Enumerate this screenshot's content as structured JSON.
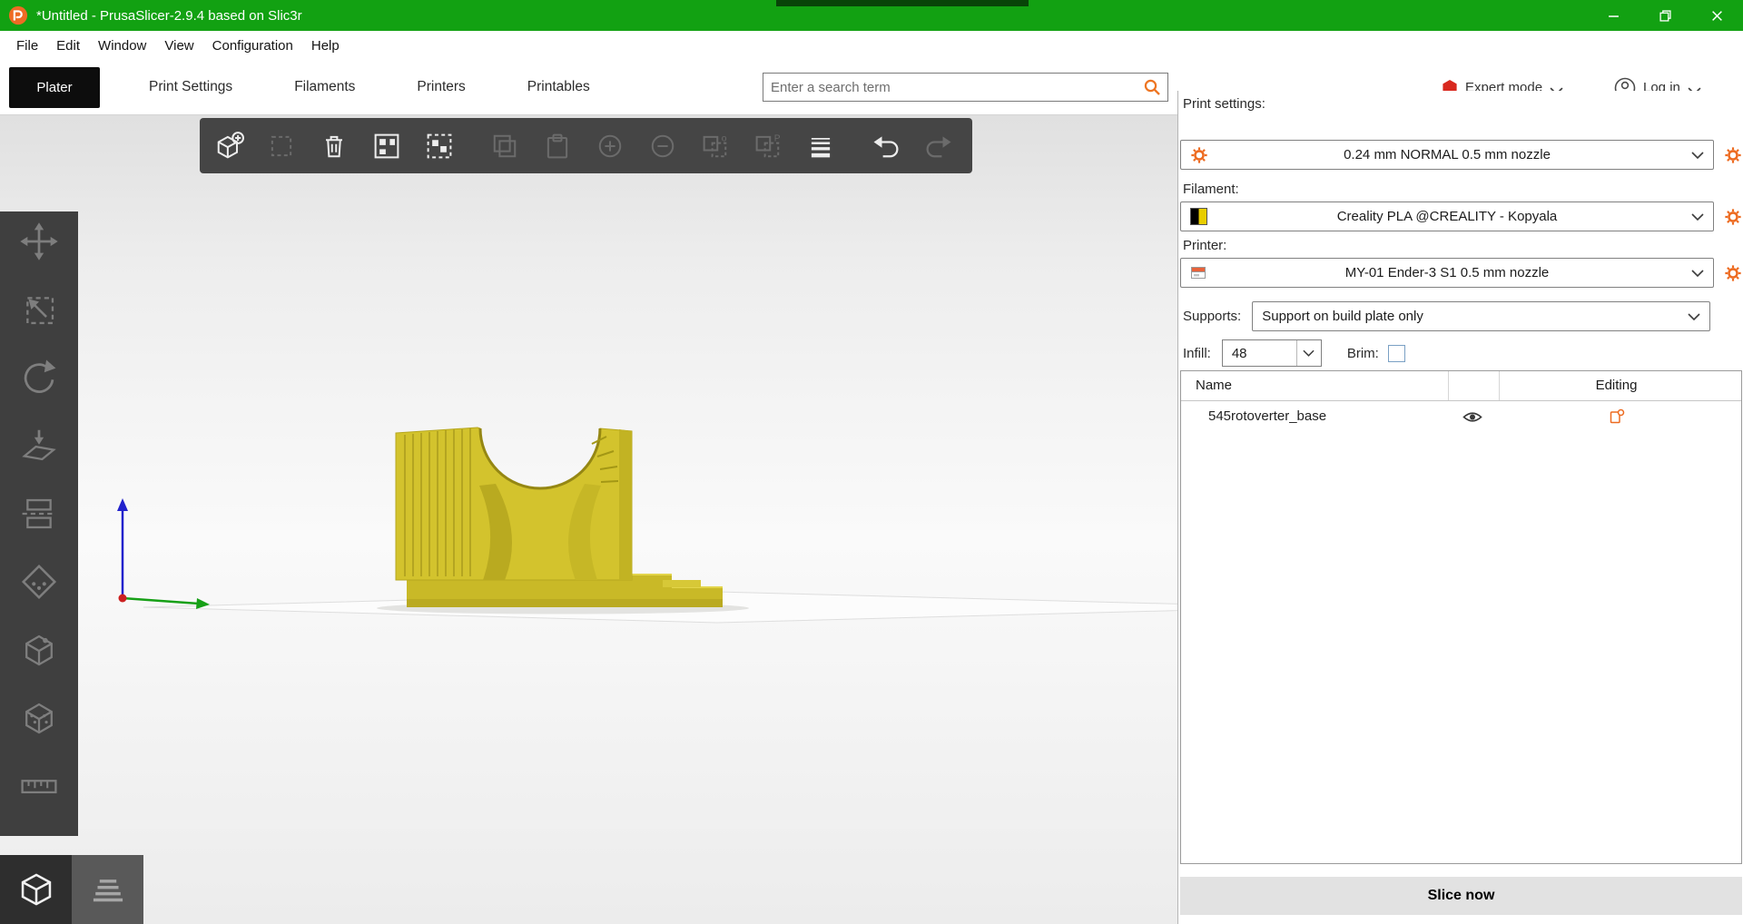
{
  "window": {
    "title": "*Untitled - PrusaSlicer-2.9.4 based on Slic3r"
  },
  "menubar": {
    "items": [
      "File",
      "Edit",
      "Window",
      "View",
      "Configuration",
      "Help"
    ]
  },
  "tabbar": {
    "tabs": [
      {
        "label": "Plater",
        "active": true
      },
      {
        "label": "Print Settings",
        "active": false
      },
      {
        "label": "Filaments",
        "active": false
      },
      {
        "label": "Printers",
        "active": false
      },
      {
        "label": "Printables",
        "active": false
      }
    ],
    "search_placeholder": "Enter a search term",
    "expert_mode_label": "Expert mode",
    "login_label": "Log in"
  },
  "viewport": {
    "toolbar_top": [
      {
        "name": "add-object",
        "enabled": true
      },
      {
        "name": "delete",
        "enabled": false
      },
      {
        "name": "delete-all",
        "enabled": true
      },
      {
        "name": "arrange",
        "enabled": true
      },
      {
        "name": "arrange-bed",
        "enabled": true
      },
      {
        "name": "copy",
        "enabled": false
      },
      {
        "name": "paste",
        "enabled": false
      },
      {
        "name": "add-instance",
        "enabled": false
      },
      {
        "name": "remove-instance",
        "enabled": false
      },
      {
        "name": "split-objects",
        "enabled": false
      },
      {
        "name": "split-parts",
        "enabled": false
      },
      {
        "name": "layer-height",
        "enabled": true
      },
      {
        "name": "undo",
        "enabled": true
      },
      {
        "name": "redo",
        "enabled": false
      }
    ],
    "toolbar_left": [
      {
        "name": "move",
        "enabled": false
      },
      {
        "name": "scale",
        "enabled": false
      },
      {
        "name": "rotate",
        "enabled": false
      },
      {
        "name": "place-on-face",
        "enabled": false
      },
      {
        "name": "cut",
        "enabled": false
      },
      {
        "name": "paint-supports",
        "enabled": false
      },
      {
        "name": "seam",
        "enabled": false
      },
      {
        "name": "fuzzy-skin",
        "enabled": false
      },
      {
        "name": "measure",
        "enabled": false
      }
    ],
    "view_buttons": [
      {
        "name": "editor-3d",
        "active": true
      },
      {
        "name": "preview-layers",
        "active": false
      }
    ]
  },
  "sidebar": {
    "print_settings_label": "Print settings:",
    "print_settings_value": "0.24 mm NORMAL 0.5 mm nozzle",
    "filament_label": "Filament:",
    "filament_value": "Creality PLA @CREALITY - Kopyala",
    "printer_label": "Printer:",
    "printer_value": "MY-01 Ender-3 S1 0.5 mm nozzle",
    "supports_label": "Supports:",
    "supports_value": "Support on build plate only",
    "infill_label": "Infill:",
    "infill_value": "48",
    "brim_label": "Brim:",
    "brim_checked": false,
    "object_list": {
      "columns": [
        "Name",
        "Editing"
      ],
      "rows": [
        {
          "name": "545rotoverter_base"
        }
      ]
    },
    "slice_button_label": "Slice now"
  },
  "colors": {
    "titlebar_green": "#12a112",
    "accent_orange": "#ed6b21",
    "expert_red": "#d8281e",
    "model_yellow": "#d2c22c"
  }
}
